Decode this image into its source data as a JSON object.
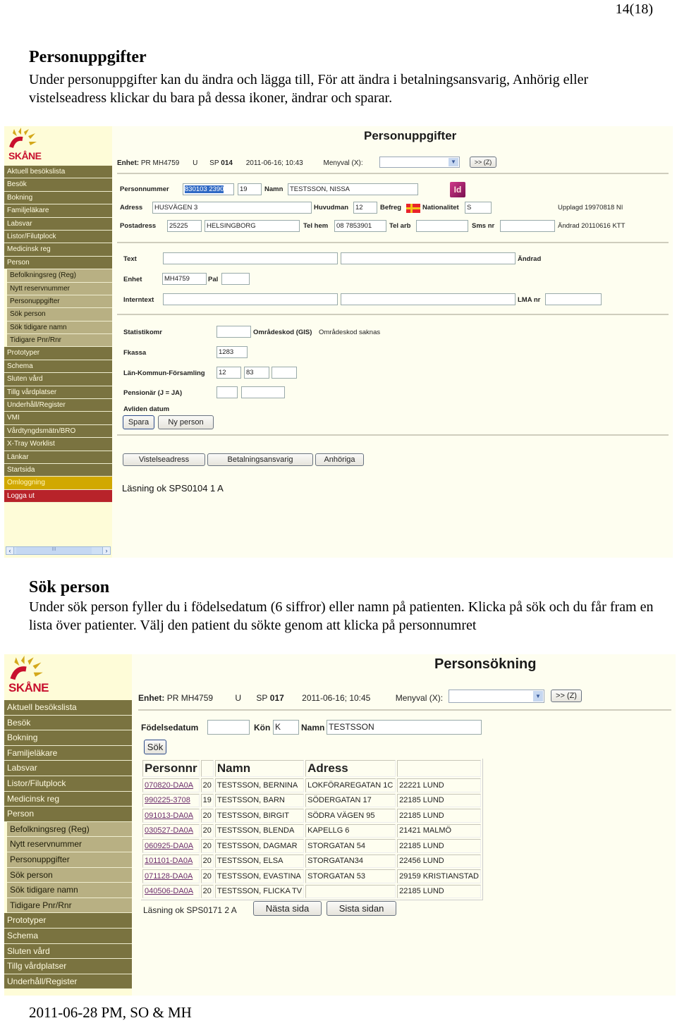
{
  "page_number": "14(18)",
  "section1": {
    "heading": "Personuppgifter",
    "body": "Under personuppgifter kan du ändra och lägga till, För att ändra i betalningsansvarig, Anhörig eller vistelseadress klickar du bara på dessa ikoner, ändrar och sparar."
  },
  "section2": {
    "heading": "Sök person",
    "body": "Under sök person fyller du i födelsedatum (6 siffror) eller namn på patienten. Klicka på sök och du får fram en lista över patienter. Välj den patient du sökte genom att klicka på personnumret"
  },
  "footer": "2011-06-28 PM, SO & MH",
  "logo": {
    "text": "SKÅNE"
  },
  "menu": {
    "main_top": [
      "Aktuell besökslista",
      "Besök",
      "Bokning",
      "Familjeläkare",
      "Labsvar",
      "Listor/Filutplock",
      "Medicinsk reg",
      "Person"
    ],
    "person_sub": [
      "Befolkningsreg (Reg)",
      "Nytt reservnummer",
      "Personuppgifter",
      "Sök person",
      "Sök tidigare namn",
      "Tidigare Pnr/Rnr"
    ],
    "main_bottom": [
      "Prototyper",
      "Schema",
      "Sluten vård",
      "Tillg vårdplatser",
      "Underhåll/Register",
      "VMI",
      "Vårdtyngdsmätn/BRO",
      "X-Tray Worklist",
      "Länkar",
      "Startsida"
    ],
    "omloggning": "Omloggning",
    "logga_ut": "Logga ut",
    "scroll_thumb": "III"
  },
  "screen1": {
    "title": "Personuppgifter",
    "header": {
      "enhet_label": "Enhet:",
      "enhet": "PR MH4759",
      "u": "U",
      "sp_label": "SP",
      "sp": "014",
      "datetime": "2011-06-16; 10:43",
      "menyval_label": "Menyval (X):",
      "go_button": ">> (Z)"
    },
    "personnummer_label": "Personnummer",
    "personnummer": "830103 2390",
    "century": "19",
    "namn_label": "Namn",
    "namn": "TESTSSON, NISSA",
    "id_icon": "Id",
    "adress_label": "Adress",
    "adress": "HUSVÄGEN 3",
    "huvudman_label": "Huvudman",
    "huvudman": "12",
    "befreg_label": "Befreg",
    "nationalitet_label": "Nationalitet",
    "nationalitet": "S",
    "upplagd": "Upplagd 19970818 NI",
    "postadress_label": "Postadress",
    "postnummer": "25225",
    "ort": "HELSINGBORG",
    "telhem_label": "Tel hem",
    "telhem": "08 7853901",
    "telarb_label": "Tel arb",
    "telarb": "",
    "sms_label": "Sms nr",
    "sms": "",
    "andrad_info": "Ändrad 20110616 KTT",
    "text_label": "Text",
    "andrad_label": "Ändrad",
    "enhet2_label": "Enhet",
    "enhet2": "MH4759",
    "pal_label": "Pal",
    "pal": "",
    "interntext_label": "Interntext",
    "lma_label": "LMA nr",
    "statistikomr_label": "Statistikomr",
    "omradeskod_label": "Områdeskod (GIS)",
    "omradeskod_value": "Områdeskod saknas",
    "fkassa_label": "Fkassa",
    "fkassa": "1283",
    "lkf_label": "Län-Kommun-Församling",
    "lan": "12",
    "kommun": "83",
    "forsamling": "",
    "pensionar_label": "Pensionär (J = JA)",
    "avliden_label": "Avliden datum",
    "spara": "Spara",
    "ny_person": "Ny person",
    "vistelseadress": "Vistelseadress",
    "betalningsansvarig": "Betalningsansvarig",
    "anhoriga": "Anhöriga",
    "status": "Läsning ok SPS0104 1 A"
  },
  "screen2": {
    "title": "Personsökning",
    "header": {
      "enhet_label": "Enhet:",
      "enhet": "PR MH4759",
      "u": "U",
      "sp_label": "SP",
      "sp": "017",
      "datetime": "2011-06-16; 10:45",
      "menyval_label": "Menyval (X):",
      "go_button": ">> (Z)"
    },
    "fodelsedatum_label": "Födelsedatum",
    "fodelsedatum": "",
    "kon_label": "Kön",
    "kon": "K",
    "namn_label": "Namn",
    "namn": "TESTSSON",
    "sok_button": "Sök",
    "table": {
      "headers": [
        "Personnr",
        "",
        "Namn",
        "Adress",
        ""
      ],
      "rows": [
        [
          "070820-DA0A",
          "20",
          "TESTSSON, BERNINA",
          "LOKFÖRAREGATAN 1C",
          "22221 LUND"
        ],
        [
          "990225-3708",
          "19",
          "TESTSSON, BARN",
          "SÖDERGATAN 17",
          "22185 LUND"
        ],
        [
          "091013-DA0A",
          "20",
          "TESTSSON, BIRGIT",
          "SÖDRA VÄGEN 95",
          "22185 LUND"
        ],
        [
          "030527-DA0A",
          "20",
          "TESTSSON, BLENDA",
          "KAPELLG 6",
          "21421 MALMÖ"
        ],
        [
          "060925-DA0A",
          "20",
          "TESTSSON, DAGMAR",
          "STORGATAN 54",
          "22185 LUND"
        ],
        [
          "101101-DA0A",
          "20",
          "TESTSSON, ELSA",
          "STORGATAN34",
          "22456 LUND"
        ],
        [
          "071128-DA0A",
          "20",
          "TESTSSON, EVASTINA",
          "STORGATAN 53",
          "29159 KRISTIANSTAD"
        ],
        [
          "040506-DA0A",
          "20",
          "TESTSSON, FLICKA TV",
          "",
          "22185 LUND"
        ]
      ]
    },
    "status": "Läsning ok SPS0171 2 A",
    "nasta_sida": "Nästa sida",
    "sista_sidan": "Sista sidan"
  }
}
